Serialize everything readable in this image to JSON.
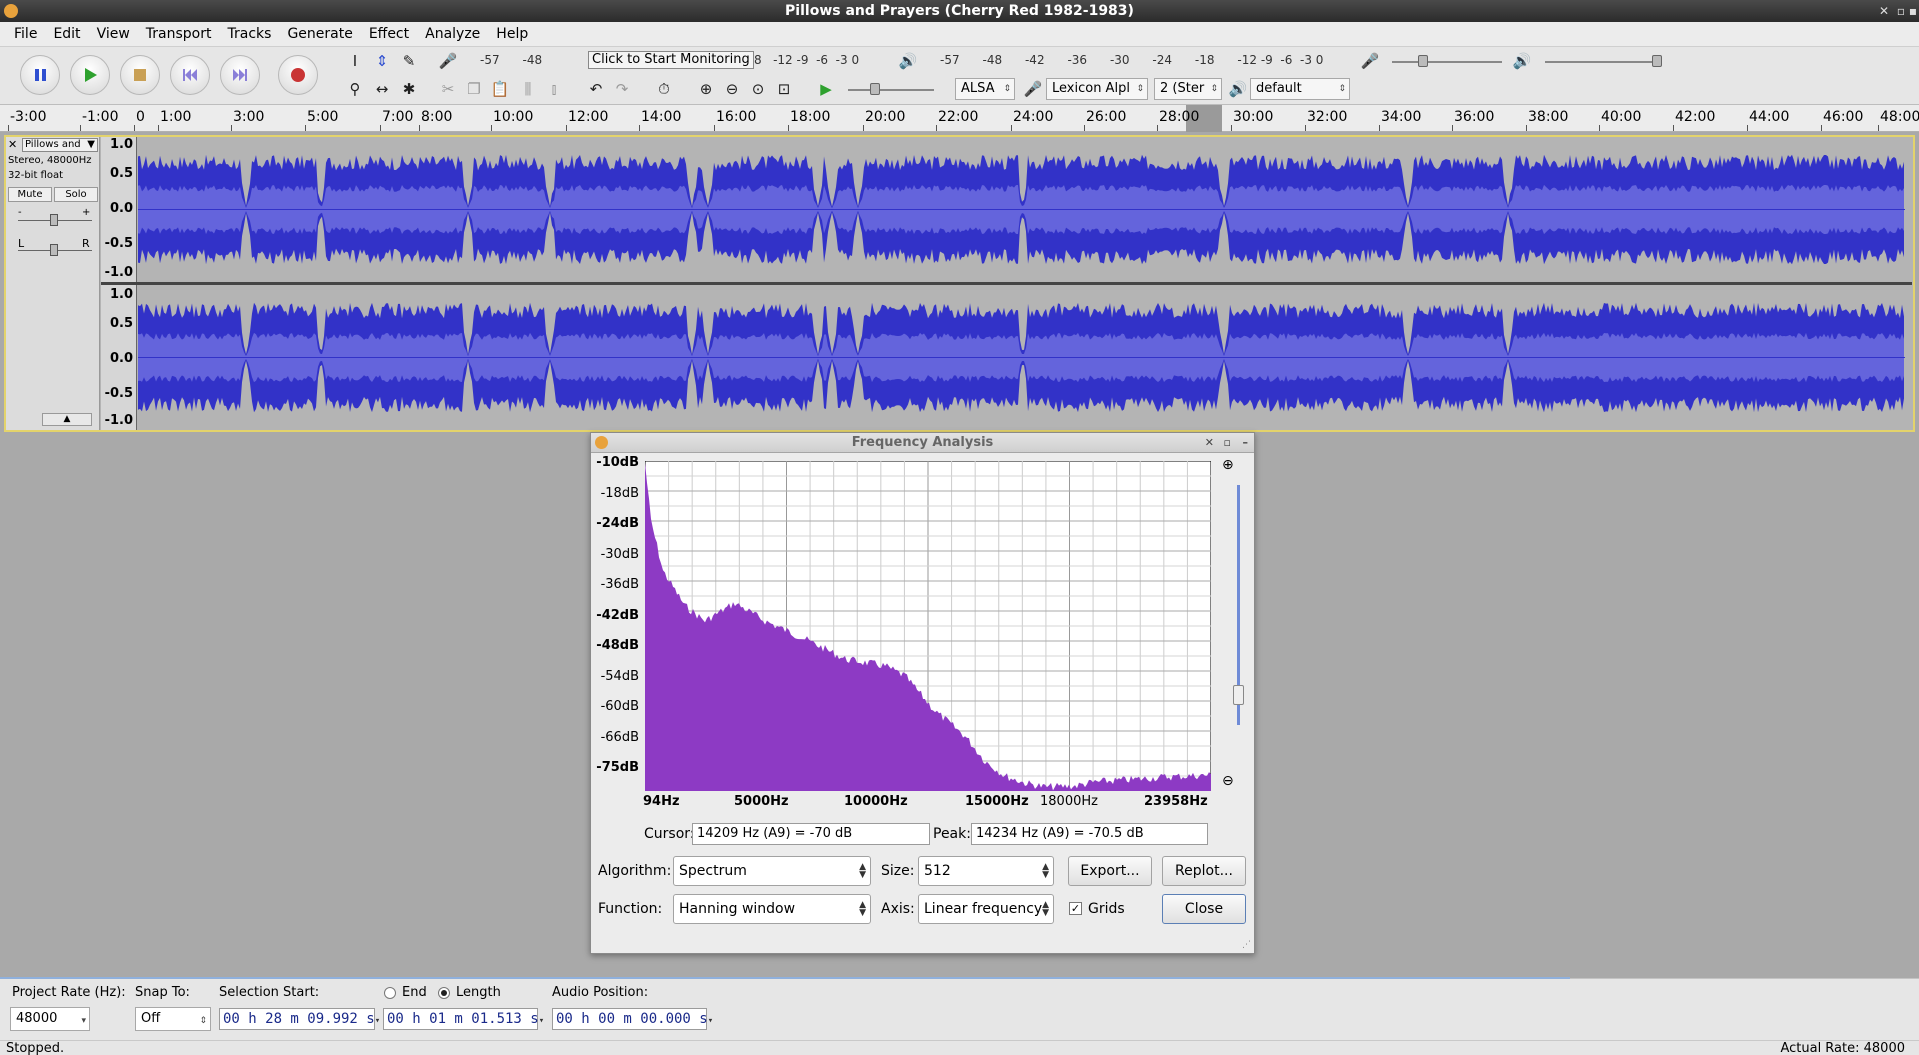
{
  "window": {
    "title": "Pillows and Prayers (Cherry Red 1982-1983)"
  },
  "menu": [
    "File",
    "Edit",
    "View",
    "Transport",
    "Tracks",
    "Generate",
    "Effect",
    "Analyze",
    "Help"
  ],
  "meters": {
    "record_scale": "-57      -48",
    "monitor_prompt": "Click to Start Monitoring",
    "record_scale_tail": "8   -12 -9  -6  -3 0",
    "playback_scale": "-57      -48      -42      -36      -30      -24      -18      -12 -9  -6  -3 0"
  },
  "devices": {
    "host": "ALSA",
    "input": "Lexicon Alpl",
    "channels": "2 (Ster",
    "output": "default"
  },
  "ruler": [
    "-3:00",
    "-1:00",
    "0",
    "1:00",
    "3:00",
    "5:00",
    "7:00",
    "8:00",
    "10:00",
    "12:00",
    "14:00",
    "16:00",
    "18:00",
    "20:00",
    "22:00",
    "24:00",
    "26:00",
    "28:00",
    "30:00",
    "32:00",
    "34:00",
    "36:00",
    "38:00",
    "40:00",
    "42:00",
    "44:00",
    "46:00",
    "48:00"
  ],
  "track": {
    "name": "Pillows and",
    "info1": "Stereo, 48000Hz",
    "info2": "32-bit float",
    "mute": "Mute",
    "solo": "Solo",
    "gain_minus": "-",
    "gain_plus": "+",
    "pan_left": "L",
    "pan_right": "R",
    "scale": [
      "1.0",
      "0.5",
      "0.0",
      "-0.5",
      "-1.0"
    ]
  },
  "dialog": {
    "title": "Frequency Analysis",
    "y_labels": [
      "-10dB",
      "-18dB",
      "-24dB",
      "-30dB",
      "-36dB",
      "-42dB",
      "-48dB",
      "-54dB",
      "-60dB",
      "-66dB",
      "-75dB"
    ],
    "x_labels": [
      "94Hz",
      "5000Hz",
      "10000Hz",
      "15000Hz",
      "18000Hz",
      "23958Hz"
    ],
    "cursor_label": "Cursor:",
    "cursor_value": "14209 Hz (A9) = -70 dB",
    "peak_label": "Peak:",
    "peak_value": "14234 Hz (A9) = -70.5 dB",
    "algorithm_label": "Algorithm:",
    "algorithm": "Spectrum",
    "size_label": "Size:",
    "size": "512",
    "export": "Export...",
    "replot": "Replot...",
    "function_label": "Function:",
    "function": "Hanning window",
    "axis_label": "Axis:",
    "axis": "Linear frequency",
    "grids": "Grids",
    "close": "Close"
  },
  "selection": {
    "project_rate_label": "Project Rate (Hz):",
    "project_rate": "48000",
    "snap_label": "Snap To:",
    "snap": "Off",
    "sel_start_label": "Selection Start:",
    "end_label": "End",
    "length_label": "Length",
    "sel_start": "00 h 28 m 09.992 s",
    "length": "00 h 01 m 01.513 s",
    "audio_pos_label": "Audio Position:",
    "audio_pos": "00 h 00 m 00.000 s"
  },
  "status": {
    "left": "Stopped.",
    "right": "Actual Rate: 48000"
  }
}
